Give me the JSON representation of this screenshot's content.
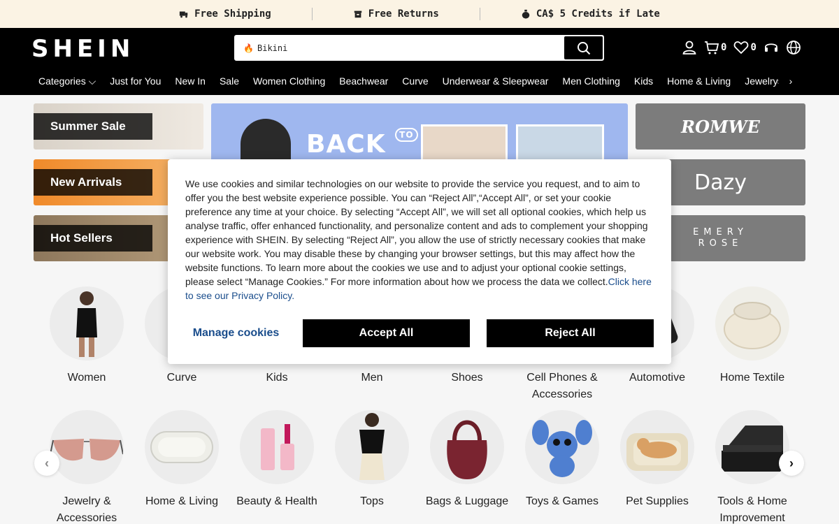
{
  "promo": {
    "shipping": "Free Shipping",
    "returns": "Free Returns",
    "credits": "CA$ 5 Credits if Late"
  },
  "header": {
    "logo": "SHEIN",
    "search_value": "Bikini",
    "cart_count": "0",
    "wishlist_count": "0"
  },
  "nav": {
    "items": [
      "Categories",
      "Just for You",
      "New In",
      "Sale",
      "Women Clothing",
      "Beachwear",
      "Curve",
      "Underwear & Sleepwear",
      "Men Clothing",
      "Kids",
      "Home & Living",
      "Jewelry & Accessories"
    ]
  },
  "banners": {
    "summer_sale": "Summer Sale",
    "new_arrivals": "New Arrivals",
    "hot_sellers": "Hot Sellers",
    "hero_text": "BACK",
    "hero_badge": "TO",
    "brand1": "ROMWE",
    "brand2": "Dazy",
    "brand3_line1": "EMERY",
    "brand3_line2": "ROSE"
  },
  "categories_row1": [
    "Women",
    "Curve",
    "Kids",
    "Men",
    "Shoes",
    "Cell Phones & Accessories",
    "Automotive",
    "Home Textile"
  ],
  "categories_row2": [
    "Jewelry & Accessories",
    "Home & Living",
    "Beauty & Health",
    "Tops",
    "Bags & Luggage",
    "Toys & Games",
    "Pet Supplies",
    "Tools & Home Improvement"
  ],
  "cookie": {
    "text": "We use cookies and similar technologies on our website to provide the service you request, and to aim to offer you the best website experience possible. You can “Reject All”,“Accept All”, or set your cookie preference any time at your choice. By selecting “Accept All”, we will set all optional cookies, which help us analyse traffic, offer enhanced functionality, and personalize content and ads to complement your shopping experience with SHEIN. By selecting “Reject All”, you allow the use of strictly necessary cookies that make our website work. You may disable these by changing your browser settings, but this may affect how the website functions. To learn more about the cookies we use and to adjust your optional cookie settings, please select “Manage Cookies.” For more information about how we process the data we collect.",
    "link": "Click here to see our Privacy Policy.",
    "manage": "Manage cookies",
    "accept": "Accept All",
    "reject": "Reject All"
  }
}
